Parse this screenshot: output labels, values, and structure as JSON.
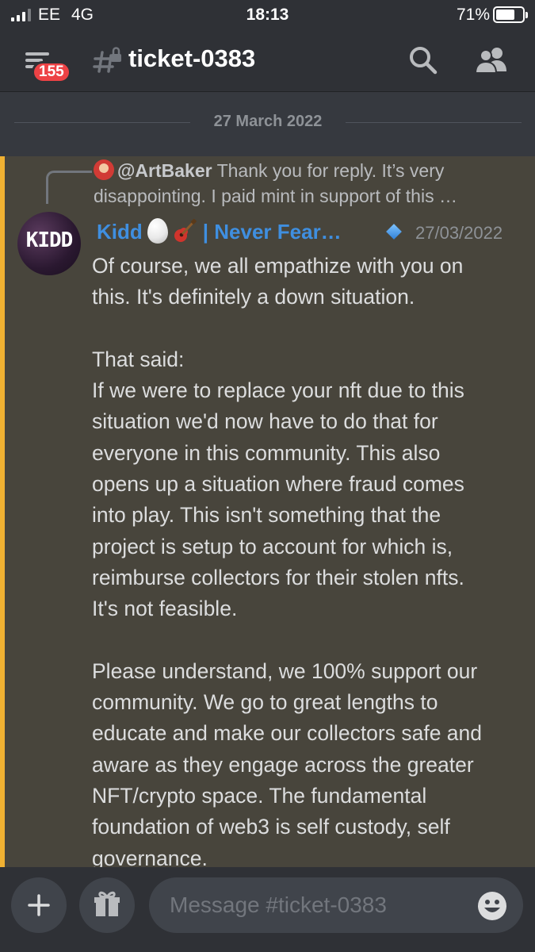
{
  "status_bar": {
    "carrier": "EE",
    "network": "4G",
    "time": "18:13",
    "battery_percent": "71%",
    "battery_level": 0.71
  },
  "header": {
    "unread_count": "155",
    "channel_name": "ticket-0383",
    "icons": [
      "menu-icon",
      "locked-channel-icon",
      "search-icon",
      "members-icon"
    ]
  },
  "date_divider": "27 March 2022",
  "message": {
    "reply": {
      "author": "@ArtBaker",
      "text": "Thank you for reply. It’s very disappointing. I paid mint in support of this …"
    },
    "avatar_text": "KIDD",
    "author": {
      "name_start": "Kidd",
      "name_end": "| Never Fear…",
      "badges": [
        "egg-emoji",
        "guitar-emoji",
        "diamond-icon"
      ]
    },
    "timestamp": "27/03/2022",
    "lines": [
      "Of course, we all empathize with you on",
      "this.  It's definitely a down situation.",
      "",
      "That said:",
      "If we were to replace your nft due to this",
      "situation we'd now have to do that for",
      "everyone in this community.  This also",
      "opens up a situation where fraud comes",
      "into play.  This isn't something that the",
      "project is setup to account for which is,",
      "reimburse collectors for their stolen nfts.",
      "It's not feasible.",
      "",
      "Please understand, we 100% support our",
      "community.  We go to great lengths to",
      "educate and make our collectors safe and",
      "aware as they engage across the greater",
      "NFT/crypto space.  The fundamental",
      "foundation of web3 is self custody, self",
      "governance."
    ]
  },
  "composer": {
    "placeholder": "Message #ticket-0383",
    "icons": [
      "plus-icon",
      "gift-icon",
      "emoji-icon"
    ]
  },
  "colors": {
    "background": "#36393f",
    "header": "#2f3136",
    "highlight_bg": "#48453c",
    "highlight_bar": "#f0b132",
    "author": "#3f8fe0",
    "badge": "#ed4245"
  }
}
